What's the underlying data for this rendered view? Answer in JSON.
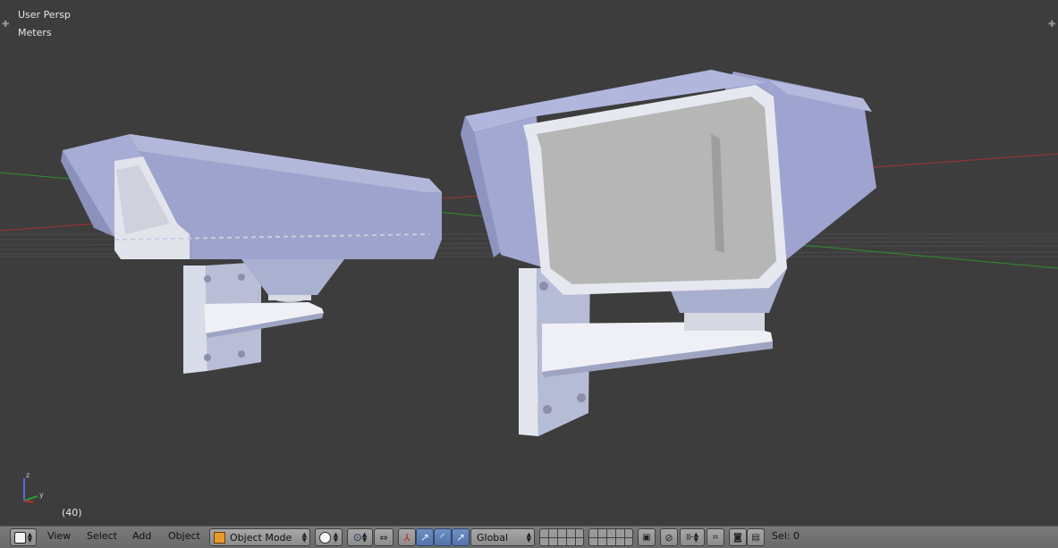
{
  "viewport": {
    "view_name": "User Persp",
    "units": "Meters",
    "frame": "(40)"
  },
  "header": {
    "menus": [
      "View",
      "Select",
      "Add",
      "Object"
    ],
    "mode": "Object Mode",
    "transform_orientation": "Global",
    "status": "Sel: 0"
  },
  "axis_labels": {
    "z": "z",
    "y": "y"
  },
  "colors": {
    "viewport_bg": "#3d3d3d",
    "header_bg": "#727272",
    "x_axis": "#b03030",
    "y_axis": "#2f9b2f",
    "model_light": "#d6d8e6",
    "model_side": "#8f95c0",
    "active_blue": "#5b7bb1"
  }
}
